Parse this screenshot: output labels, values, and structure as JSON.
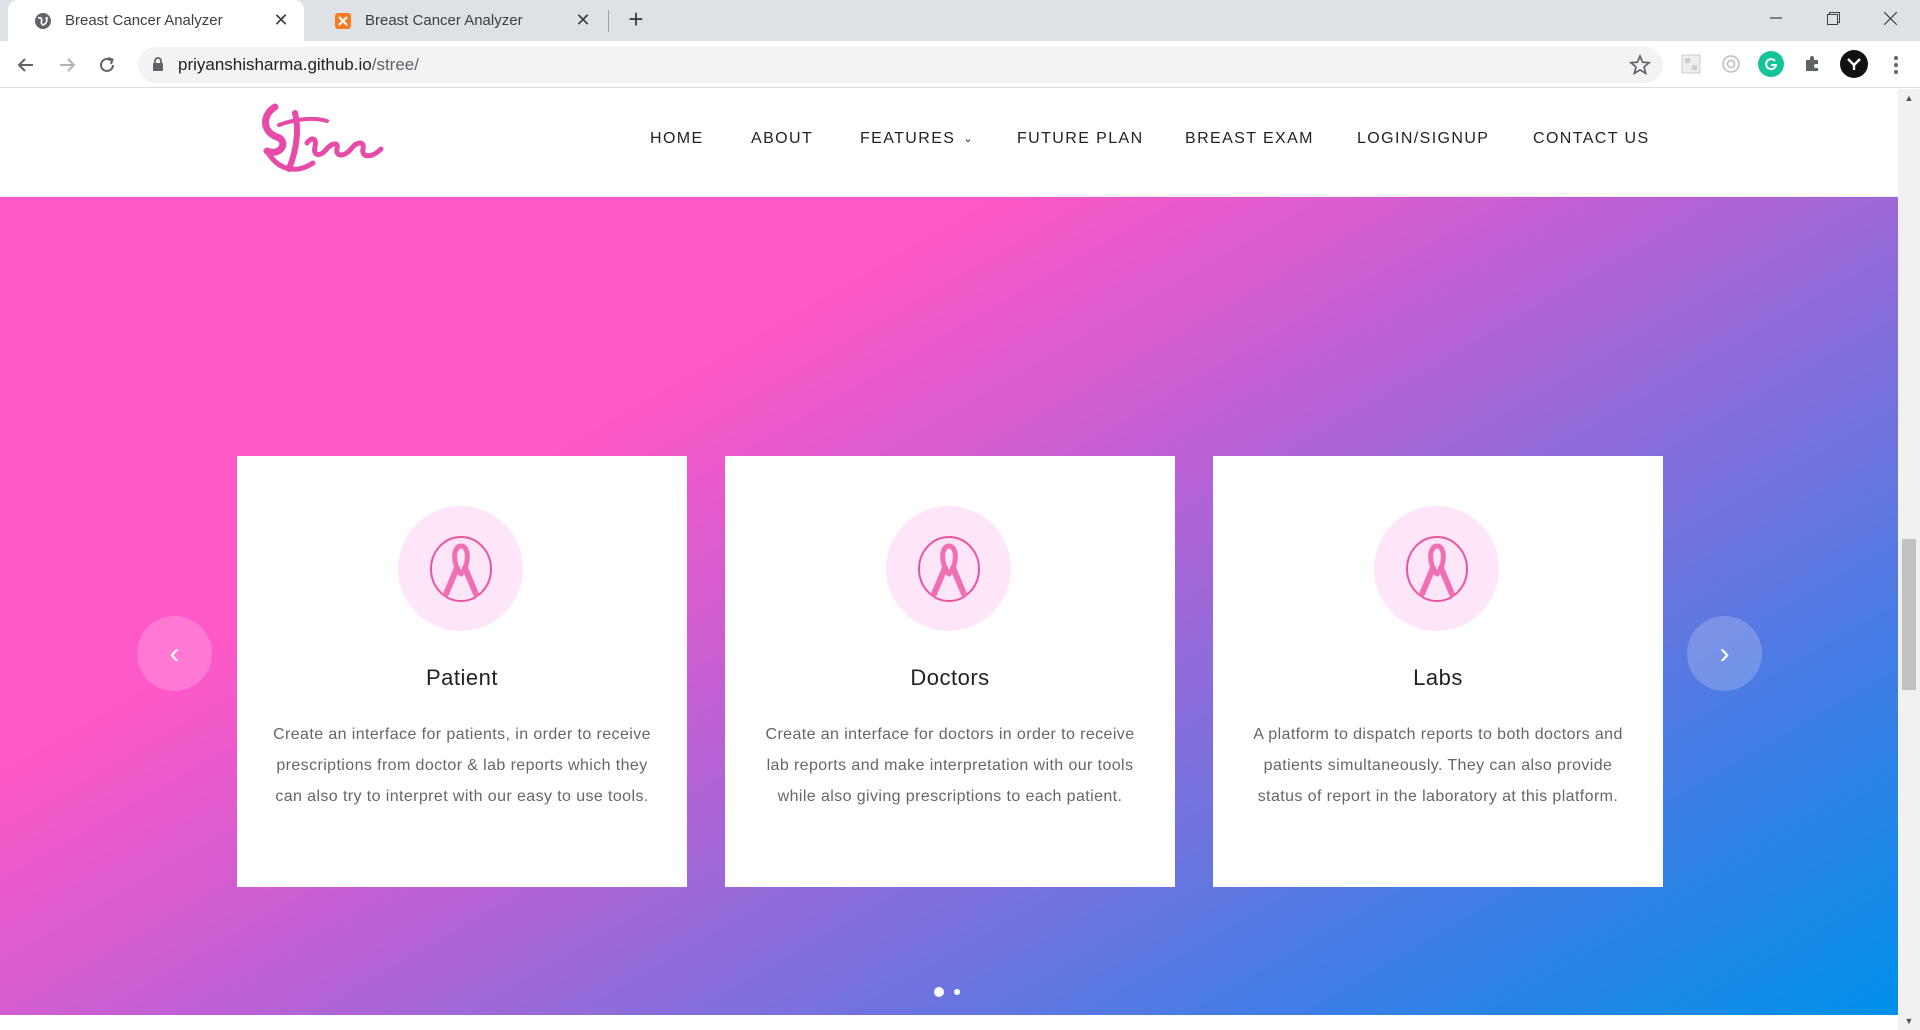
{
  "browser": {
    "tabs": [
      {
        "title": "Breast Cancer Analyzer",
        "active": true
      },
      {
        "title": "Breast Cancer Analyzer",
        "active": false
      }
    ],
    "new_tab_label": "+",
    "address": {
      "host": "priyanshisharma.github.io",
      "path": "/stree/"
    }
  },
  "site": {
    "logo_text": "Stree",
    "nav": [
      {
        "label": "HOME"
      },
      {
        "label": "ABOUT"
      },
      {
        "label": "FEATURES",
        "has_dropdown": true
      },
      {
        "label": "FUTURE PLAN"
      },
      {
        "label": "BREAST EXAM"
      },
      {
        "label": "LOGIN/SIGNUP"
      },
      {
        "label": "CONTACT US"
      }
    ]
  },
  "slider": {
    "prev_label": "‹",
    "next_label": "›",
    "cards": [
      {
        "icon": "pink-ribbon-icon",
        "title": "Patient",
        "text": "Create an interface for patients, in order to receive prescriptions from doctor & lab reports which they can also try to interpret with our easy to use tools."
      },
      {
        "icon": "pink-ribbon-icon",
        "title": "Doctors",
        "text": "Create an interface for doctors in order to receive lab reports and make interpretation with our tools while also giving prescriptions to each patient."
      },
      {
        "icon": "pink-ribbon-icon",
        "title": "Labs",
        "text": "A platform to dispatch reports to both doctors and patients simultaneously. They can also provide status of report in the laboratory at this platform."
      }
    ],
    "pages": 2,
    "active_page": 1
  },
  "colors": {
    "gradient_start": "#ff58c8",
    "gradient_end": "#0091ea",
    "brand_pink": "#e84aa8",
    "icon_bg": "#ffe5f8"
  }
}
